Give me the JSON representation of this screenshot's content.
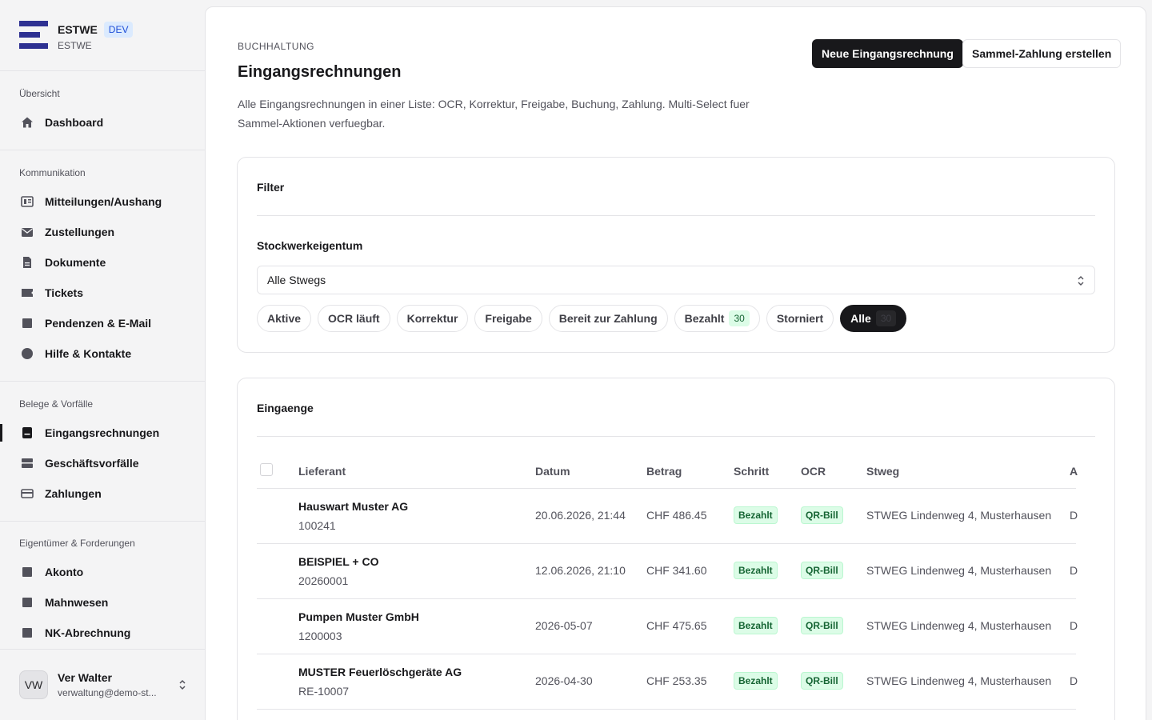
{
  "brand": {
    "name": "ESTWE",
    "badge": "DEV",
    "sub": "ESTWE"
  },
  "sidebar": {
    "sections": [
      {
        "label": "Übersicht",
        "items": [
          {
            "label": "Dashboard",
            "icon": "home-icon"
          }
        ]
      },
      {
        "label": "Kommunikation",
        "items": [
          {
            "label": "Mitteilungen/Aushang",
            "icon": "newspaper-icon"
          },
          {
            "label": "Zustellungen",
            "icon": "mail-icon"
          },
          {
            "label": "Dokumente",
            "icon": "document-icon"
          },
          {
            "label": "Tickets",
            "icon": "ticket-icon"
          },
          {
            "label": "Pendenzen & E-Mail",
            "icon": "square-icon"
          },
          {
            "label": "Hilfe & Kontakte",
            "icon": "circle-icon"
          }
        ]
      },
      {
        "label": "Belege & Vorfälle",
        "items": [
          {
            "label": "Eingangsrechnungen",
            "icon": "receipt-icon"
          },
          {
            "label": "Geschäftsvorfälle",
            "icon": "stack-icon"
          },
          {
            "label": "Zahlungen",
            "icon": "card-icon"
          }
        ]
      },
      {
        "label": "Eigentümer & Forderungen",
        "items": [
          {
            "label": "Akonto",
            "icon": "square-icon"
          },
          {
            "label": "Mahnwesen",
            "icon": "square-icon"
          },
          {
            "label": "NK-Abrechnung",
            "icon": "square-icon"
          }
        ]
      }
    ]
  },
  "user": {
    "initials": "VW",
    "name": "Ver Walter",
    "email": "verwaltung@demo-st..."
  },
  "header": {
    "crumb": "BUCHHALTUNG",
    "title": "Eingangsrechnungen",
    "description": "Alle Eingangsrechnungen in einer Liste: OCR, Korrektur, Freigabe, Buchung, Zahlung. Multi-Select fuer Sammel-Aktionen verfuegbar.",
    "primary_button": "Neue Eingangsrechnung",
    "secondary_button": "Sammel-Zahlung erstellen"
  },
  "filter": {
    "title": "Filter",
    "field_label": "Stockwerkeigentum",
    "select_value": "Alle Stwegs",
    "chips": [
      {
        "label": "Aktive",
        "count": ""
      },
      {
        "label": "OCR läuft",
        "count": ""
      },
      {
        "label": "Korrektur",
        "count": ""
      },
      {
        "label": "Freigabe",
        "count": ""
      },
      {
        "label": "Bereit zur Zahlung",
        "count": ""
      },
      {
        "label": "Bezahlt",
        "count": "30"
      },
      {
        "label": "Storniert",
        "count": ""
      },
      {
        "label": "Alle",
        "count": "30"
      }
    ]
  },
  "table": {
    "title": "Eingaenge",
    "columns": {
      "supplier": "Lieferant",
      "date": "Datum",
      "amount": "Betrag",
      "step": "Schritt",
      "ocr": "OCR",
      "stweg": "Stweg",
      "truncated": "A"
    },
    "rows": [
      {
        "supplier": "Hauswart Muster AG",
        "number": "100241",
        "date": "20.06.2026, 21:44",
        "amount": "CHF 486.45",
        "step": "Bezahlt",
        "ocr": "QR-Bill",
        "stweg": "STWEG Lindenweg 4, Musterhausen",
        "truncated": "D"
      },
      {
        "supplier": "BEISPIEL + CO",
        "number": "20260001",
        "date": "12.06.2026, 21:10",
        "amount": "CHF 341.60",
        "step": "Bezahlt",
        "ocr": "QR-Bill",
        "stweg": "STWEG Lindenweg 4, Musterhausen",
        "truncated": "D"
      },
      {
        "supplier": "Pumpen Muster GmbH",
        "number": "1200003",
        "date": "2026-05-07",
        "amount": "CHF 475.65",
        "step": "Bezahlt",
        "ocr": "QR-Bill",
        "stweg": "STWEG Lindenweg 4, Musterhausen",
        "truncated": "D"
      },
      {
        "supplier": "MUSTER Feuerlöschgeräte AG",
        "number": "RE-10007",
        "date": "2026-04-30",
        "amount": "CHF 253.35",
        "step": "Bezahlt",
        "ocr": "QR-Bill",
        "stweg": "STWEG Lindenweg 4, Musterhausen",
        "truncated": "D"
      }
    ]
  },
  "colors": {
    "accent": "#18181b",
    "brand": "#2e3192",
    "success_bg": "#dcfce7",
    "success_text": "#166534"
  }
}
